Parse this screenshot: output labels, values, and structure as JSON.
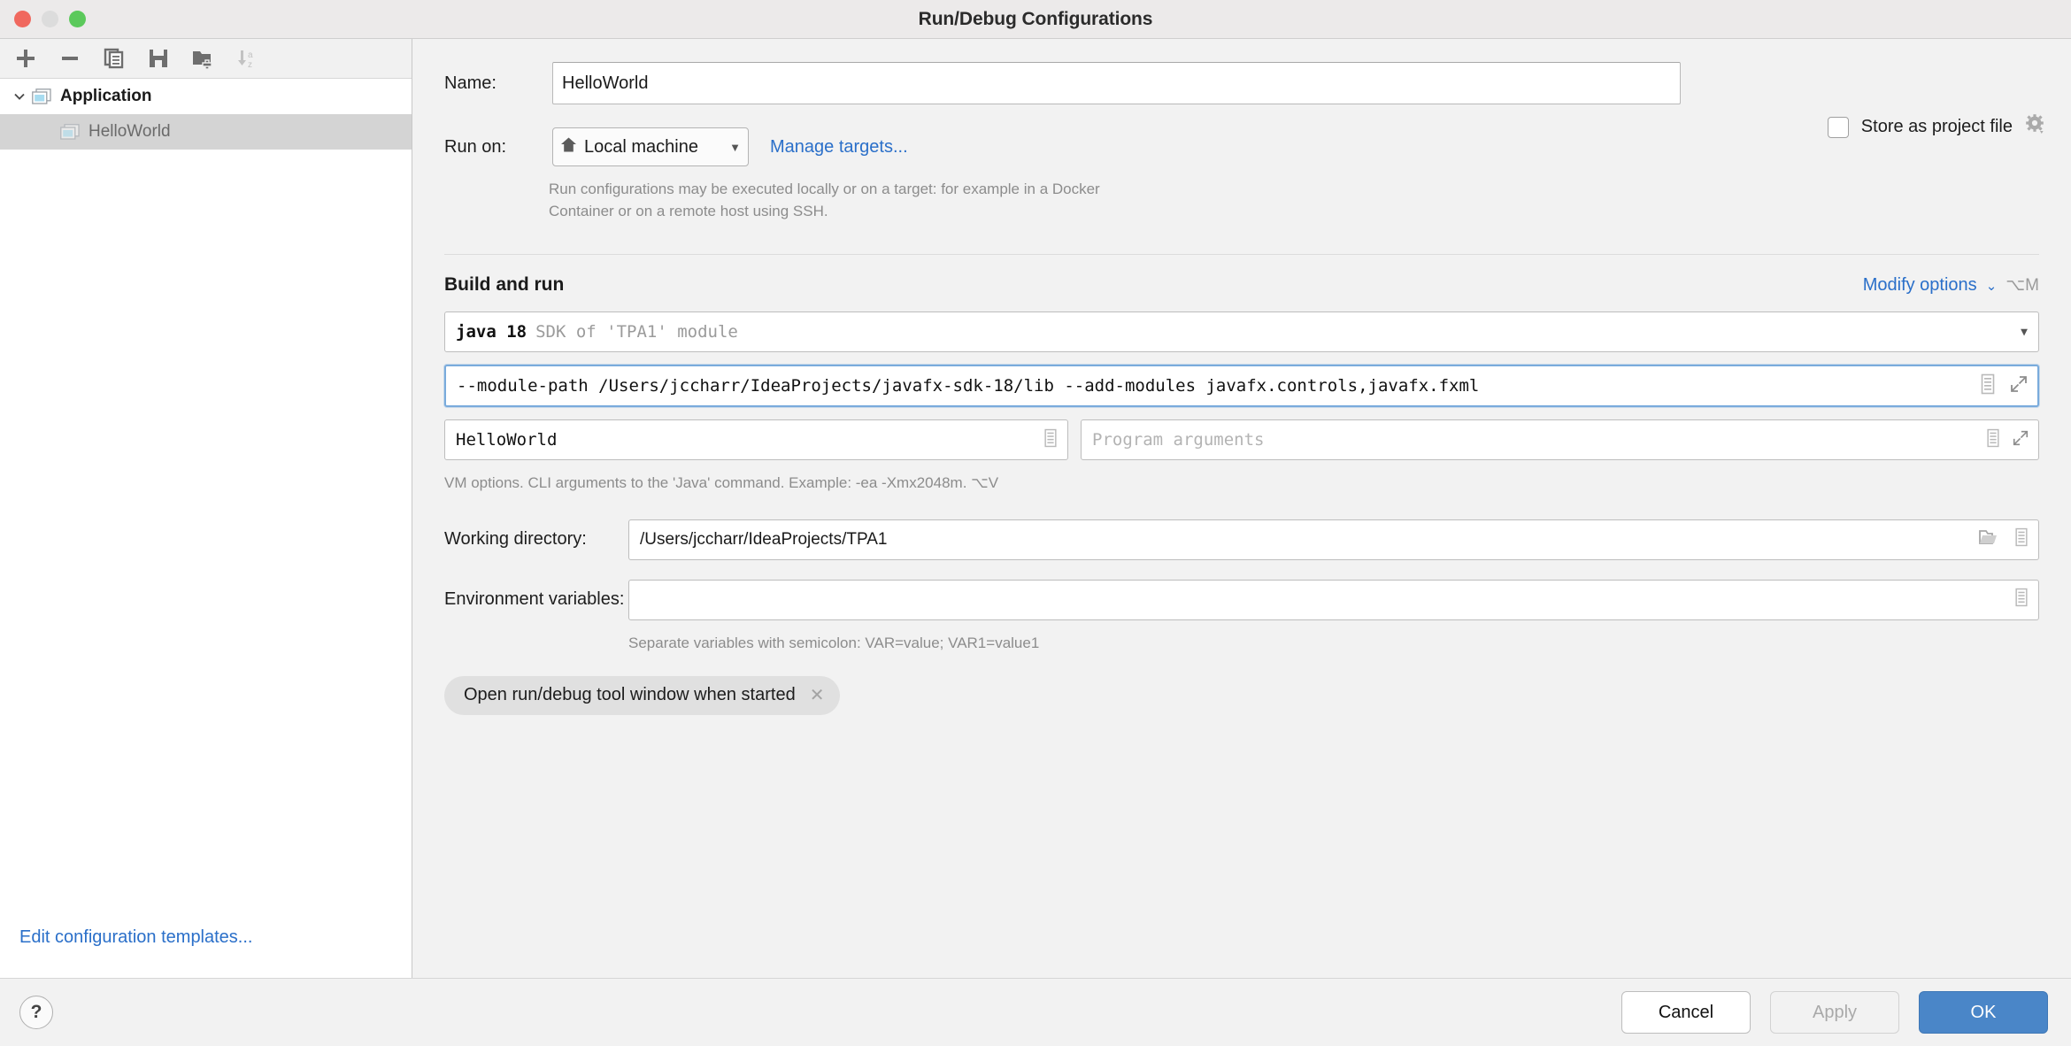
{
  "window": {
    "title": "Run/Debug Configurations",
    "traffic_lights": [
      "close",
      "minimize",
      "zoom"
    ]
  },
  "sidebar": {
    "toolbar": [
      {
        "name": "add-configuration-button",
        "icon": "plus-icon",
        "enabled": true
      },
      {
        "name": "remove-configuration-button",
        "icon": "minus-icon",
        "enabled": true
      },
      {
        "name": "copy-configuration-button",
        "icon": "copy-icon",
        "enabled": true
      },
      {
        "name": "save-configuration-button",
        "icon": "save-icon",
        "enabled": true
      },
      {
        "name": "new-folder-button",
        "icon": "new-folder-icon",
        "enabled": true
      },
      {
        "name": "sort-alphabetically-button",
        "icon": "sort-az-icon",
        "enabled": false
      }
    ],
    "tree": [
      {
        "label": "Application",
        "type": "group",
        "expanded": true,
        "icon": "application-icon"
      },
      {
        "label": "HelloWorld",
        "type": "item",
        "selected": true,
        "icon": "application-icon"
      }
    ],
    "edit_templates_link": "Edit configuration templates..."
  },
  "form": {
    "name_label": "Name:",
    "name_value": "HelloWorld",
    "store_as_project_file_label": "Store as project file",
    "store_as_project_file_checked": false,
    "store_gear_icon": "gear-dropdown-icon",
    "run_on_label": "Run on:",
    "run_on_value": "Local machine",
    "run_on_icon": "home-icon",
    "manage_targets_link": "Manage targets...",
    "run_on_hint": "Run configurations may be executed locally or on a target: for example in a Docker Container or on a remote host using SSH.",
    "section_title": "Build and run",
    "modify_options_link": "Modify options",
    "modify_options_shortcut": "⌥M",
    "sdk_value": "java 18",
    "sdk_description": "SDK of 'TPA1' module",
    "vm_options_value": "--module-path /Users/jccharr/IdeaProjects/javafx-sdk-18/lib --add-modules javafx.controls,javafx.fxml",
    "main_class_value": "HelloWorld",
    "program_arguments_placeholder": "Program arguments",
    "vm_options_hint": "VM options. CLI arguments to the 'Java' command. Example: -ea -Xmx2048m. ⌥V",
    "working_directory_label": "Working directory:",
    "working_directory_value": "/Users/jccharr/IdeaProjects/TPA1",
    "environment_variables_label": "Environment variables:",
    "environment_variables_value": "",
    "environment_variables_hint": "Separate variables with semicolon: VAR=value; VAR1=value1",
    "option_chip_label": "Open run/debug tool window when started",
    "option_chip_remove_icon": "close-x-icon"
  },
  "footer": {
    "help_label": "?",
    "cancel_label": "Cancel",
    "apply_label": "Apply",
    "apply_enabled": false,
    "ok_label": "OK"
  },
  "colors": {
    "accent_blue": "#2a6fc9",
    "primary_button": "#4a86c8",
    "focus_border": "#7aabdc",
    "selection_gray": "#d4d4d4"
  }
}
